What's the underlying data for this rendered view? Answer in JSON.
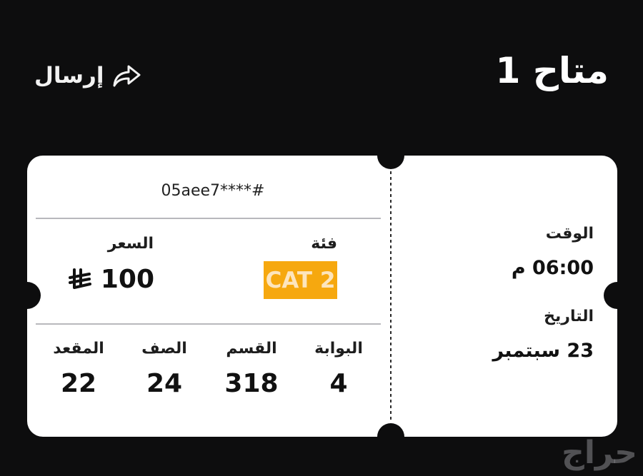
{
  "header": {
    "title": "متاح 1",
    "send_label": "إرسال"
  },
  "ticket": {
    "id": "05aee7****#",
    "category_label": "فئة",
    "category_value": "CAT 2",
    "price_label": "السعر",
    "price_value": "100",
    "seat_info": [
      {
        "label": "البوابة",
        "value": "4"
      },
      {
        "label": "القسم",
        "value": "318"
      },
      {
        "label": "الصف",
        "value": "24"
      },
      {
        "label": "المقعد",
        "value": "22"
      }
    ],
    "time_label": "الوقت",
    "time_value": "06:00 م",
    "date_label": "التاريخ",
    "date_value": "23 سبتمبر"
  },
  "watermark": "حراج",
  "colors": {
    "background": "#0d0d0e",
    "ticket": "#ffffff",
    "category_badge": "#f6a80f",
    "divider": "#b8b8bc"
  },
  "icons": {
    "send": "share-forward-icon",
    "currency": "saudi-riyal-icon"
  }
}
